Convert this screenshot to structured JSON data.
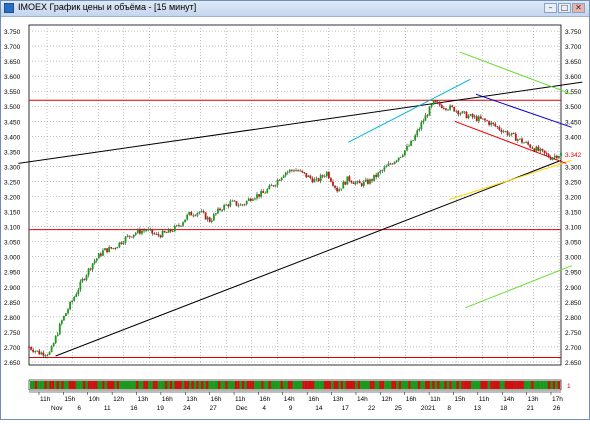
{
  "window": {
    "title": "IMOEX График цены и объёма - [15 минут]",
    "controls": {
      "minimize": "–",
      "maximize": "□",
      "close": "✕"
    }
  },
  "y_axis": {
    "labels": [
      "3.750",
      "3.700",
      "3.650",
      "3.600",
      "3.550",
      "3.500",
      "3.450",
      "3.400",
      "3.350",
      "3.300",
      "3.250",
      "3.200",
      "3.150",
      "3.100",
      "3.050",
      "3.000",
      "2.950",
      "2.900",
      "2.850",
      "2.800",
      "2.750",
      "2.700",
      "2.650"
    ],
    "current_price_label": "3.342",
    "volume_label": "1"
  },
  "x_axis": {
    "day_labels": [
      "11h",
      "15h",
      "6",
      "11",
      "16",
      "19",
      "24",
      "27",
      "Dec",
      "4",
      "9",
      "14",
      "17",
      "22",
      "25",
      "2021",
      "8",
      "13",
      "18",
      "21",
      "26"
    ],
    "hour_labels": [
      "11h",
      "15h",
      "10h",
      "12h",
      "13h",
      "16h",
      "13h",
      "16h",
      "11h",
      "16h",
      "14h",
      "16h",
      "13h",
      "14h",
      "12h",
      "16h",
      "11h",
      "15h",
      "11h",
      "14h",
      "13h",
      "17h"
    ],
    "month_labels": [
      "Nov",
      "6",
      "11",
      "16",
      "19",
      "24",
      "27",
      "Dec",
      "4",
      "9",
      "14",
      "17",
      "22",
      "25",
      "2021",
      "8",
      "13",
      "18",
      "21",
      "26"
    ]
  },
  "chart_data": {
    "type": "candlestick",
    "instrument": "IMOEX",
    "timeframe": "15 минут",
    "ylim": [
      2.64,
      3.77
    ],
    "price_path": [
      [
        0,
        2.7
      ],
      [
        0.02,
        2.68
      ],
      [
        0.04,
        2.68
      ],
      [
        0.06,
        2.78
      ],
      [
        0.08,
        2.85
      ],
      [
        0.1,
        2.92
      ],
      [
        0.12,
        2.98
      ],
      [
        0.14,
        3.02
      ],
      [
        0.16,
        3.03
      ],
      [
        0.18,
        3.06
      ],
      [
        0.2,
        3.08
      ],
      [
        0.22,
        3.09
      ],
      [
        0.24,
        3.07
      ],
      [
        0.26,
        3.08
      ],
      [
        0.28,
        3.1
      ],
      [
        0.3,
        3.14
      ],
      [
        0.32,
        3.15
      ],
      [
        0.34,
        3.12
      ],
      [
        0.36,
        3.16
      ],
      [
        0.38,
        3.18
      ],
      [
        0.4,
        3.17
      ],
      [
        0.42,
        3.2
      ],
      [
        0.44,
        3.21
      ],
      [
        0.46,
        3.24
      ],
      [
        0.48,
        3.28
      ],
      [
        0.5,
        3.29
      ],
      [
        0.52,
        3.27
      ],
      [
        0.54,
        3.25
      ],
      [
        0.56,
        3.28
      ],
      [
        0.58,
        3.22
      ],
      [
        0.6,
        3.26
      ],
      [
        0.62,
        3.24
      ],
      [
        0.64,
        3.25
      ],
      [
        0.66,
        3.28
      ],
      [
        0.68,
        3.31
      ],
      [
        0.7,
        3.34
      ],
      [
        0.72,
        3.38
      ],
      [
        0.74,
        3.45
      ],
      [
        0.76,
        3.51
      ],
      [
        0.78,
        3.5
      ],
      [
        0.8,
        3.49
      ],
      [
        0.82,
        3.47
      ],
      [
        0.84,
        3.46
      ],
      [
        0.86,
        3.45
      ],
      [
        0.88,
        3.43
      ],
      [
        0.9,
        3.41
      ],
      [
        0.92,
        3.39
      ],
      [
        0.94,
        3.37
      ],
      [
        0.96,
        3.35
      ],
      [
        0.98,
        3.33
      ],
      [
        1.0,
        3.342
      ]
    ],
    "current_price": 3.342,
    "horizontal_levels": [
      3.52,
      3.09,
      2.665
    ],
    "trend_lines": [
      {
        "color": "#000000",
        "from": [
          -0.02,
          3.31
        ],
        "to": [
          1.04,
          3.58
        ]
      },
      {
        "color": "#000000",
        "from": [
          0.05,
          2.67
        ],
        "to": [
          1.0,
          3.32
        ]
      },
      {
        "color": "#ffd700",
        "from": [
          0.79,
          3.19
        ],
        "to": [
          1.02,
          3.32
        ]
      },
      {
        "color": "#00b7d9",
        "from": [
          0.6,
          3.38
        ],
        "to": [
          0.83,
          3.59
        ]
      },
      {
        "color": "#66dd33",
        "from": [
          0.81,
          3.68
        ],
        "to": [
          1.02,
          3.54
        ]
      },
      {
        "color": "#66dd33",
        "from": [
          0.82,
          2.83
        ],
        "to": [
          1.02,
          2.97
        ]
      },
      {
        "color": "#0000cc",
        "from": [
          0.84,
          3.54
        ],
        "to": [
          1.02,
          3.43
        ]
      },
      {
        "color": "#ee0000",
        "from": [
          0.8,
          3.45
        ],
        "to": [
          1.01,
          3.31
        ]
      }
    ]
  }
}
